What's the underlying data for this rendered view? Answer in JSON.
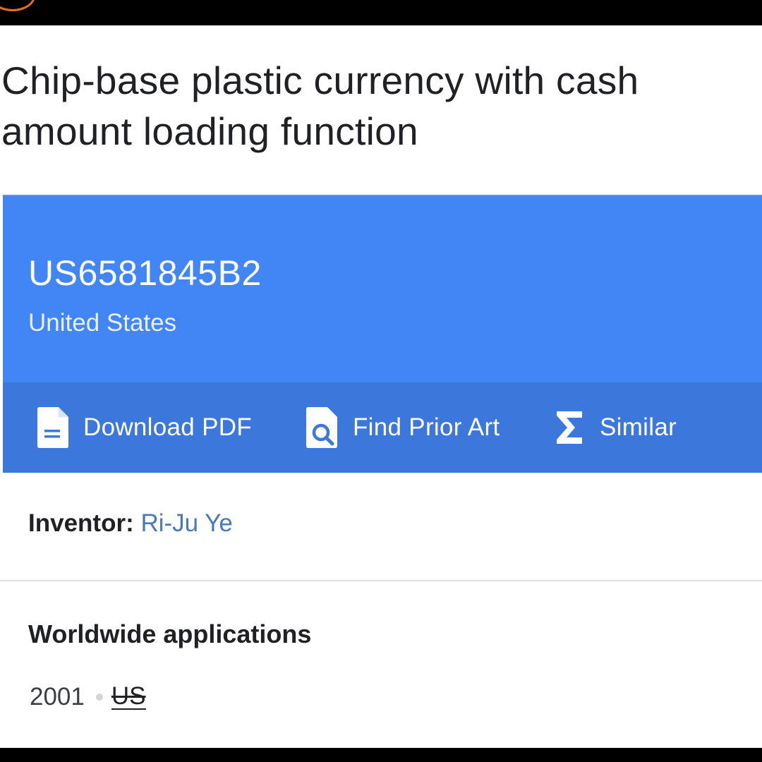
{
  "patent": {
    "title": "Chip-base plastic currency with cash amount loading function",
    "number": "US6581845B2",
    "country": "United States"
  },
  "actions": [
    {
      "label": "Download PDF",
      "icon": "document-icon"
    },
    {
      "label": "Find Prior Art",
      "icon": "search-document-icon"
    },
    {
      "label": "Similar",
      "icon": "sigma-icon"
    }
  ],
  "inventor": {
    "label": "Inventor:",
    "name": "Ri-Ju Ye"
  },
  "worldwide": {
    "title": "Worldwide applications",
    "year": "2001",
    "country": "US"
  },
  "colors": {
    "header_bg": "#4285f4",
    "actions_bg": "#3c78db",
    "link": "#4a78b9",
    "text": "#202124"
  }
}
